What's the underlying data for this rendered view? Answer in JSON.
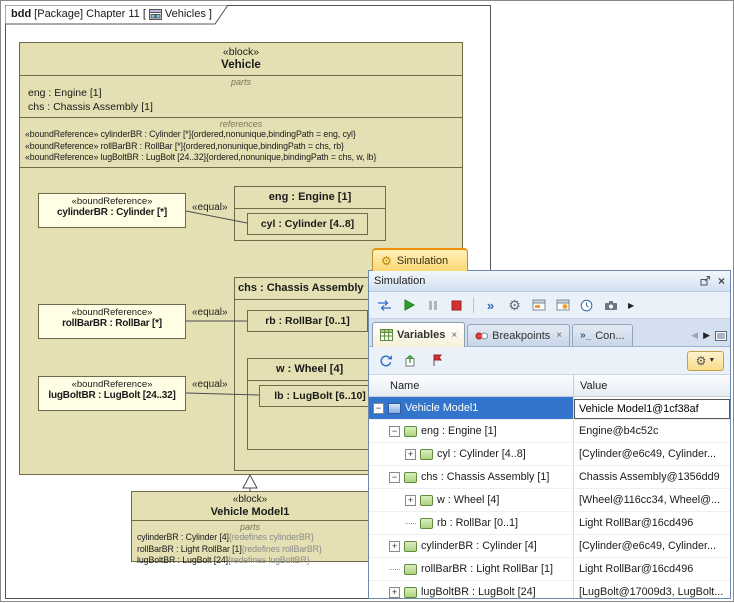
{
  "frame": {
    "kind": "bdd",
    "context": " [Package] Chapter 11 [",
    "diagram_name": "Vehicles",
    "suffix": "]"
  },
  "vehicle": {
    "stereotype": "«block»",
    "name": "Vehicle",
    "parts_label": "parts",
    "parts": [
      "eng : Engine [1]",
      "chs : Chassis Assembly [1]"
    ],
    "references_label": "references",
    "references": [
      "«boundReference» cylinderBR : Cylinder [*]{ordered,nonunique,bindingPath = eng, cyl}",
      "«boundReference» rollBarBR : RollBar [*]{ordered,nonunique,bindingPath = chs, rb}",
      "«boundReference» lugBoltBR : LugBolt [24..32]{ordered,nonunique,bindingPath = chs, w, lb}"
    ]
  },
  "bound_refs": [
    {
      "stereotype": "«boundReference»",
      "name": "cylinderBR : Cylinder [*]"
    },
    {
      "stereotype": "«boundReference»",
      "name": "rollBarBR : RollBar [*]"
    },
    {
      "stereotype": "«boundReference»",
      "name": "lugBoltBR : LugBolt [24..32]"
    }
  ],
  "connectors": {
    "equal_label": "«equal»"
  },
  "parts": {
    "eng_title": "eng : Engine [1]",
    "cyl": "cyl : Cylinder [4..8]",
    "chs_title": "chs : Chassis Assembly",
    "rb": "rb : RollBar [0..1]",
    "w_title": "w : Wheel [4]",
    "lb": "lb : LugBolt [6..10]"
  },
  "vehicle_model1": {
    "stereotype": "«block»",
    "name": "Vehicle Model1",
    "parts_label": "parts",
    "parts": [
      {
        "text": "cylinderBR : Cylinder [4]",
        "modifier": "{redefines cylinderBR}"
      },
      {
        "text": "rollBarBR : Light RollBar [1]",
        "modifier": "{redefines rollBarBR}"
      },
      {
        "text": "lugBoltBR : LugBolt [24]",
        "modifier": "{redefines lugBoltBR}"
      }
    ]
  },
  "simulation": {
    "dock_tab_label": "Simulation",
    "window_title": "Simulation",
    "tabs": {
      "variables": "Variables",
      "breakpoints": "Breakpoints",
      "console": "Con..."
    },
    "table": {
      "columns": {
        "name": "Name",
        "value": "Value"
      },
      "rows": [
        {
          "name": "Vehicle Model1",
          "value": "Vehicle Model1@1cf38af"
        },
        {
          "name": "eng : Engine [1]",
          "value": "Engine@b4c52c"
        },
        {
          "name": "cyl : Cylinder [4..8]",
          "value": "[Cylinder@e6c49, Cylinder..."
        },
        {
          "name": "chs : Chassis Assembly [1]",
          "value": "Chassis Assembly@1356dd9"
        },
        {
          "name": "w : Wheel [4]",
          "value": "[Wheel@116cc34, Wheel@..."
        },
        {
          "name": "rb : RollBar [0..1]",
          "value": "Light RollBar@16cd496"
        },
        {
          "name": "cylinderBR : Cylinder [4]",
          "value": "[Cylinder@e6c49, Cylinder..."
        },
        {
          "name": "rollBarBR : Light RollBar [1]",
          "value": "Light RollBar@16cd496"
        },
        {
          "name": "lugBoltBR : LugBolt [24]",
          "value": "[LugBolt@17009d3, LugBolt..."
        }
      ]
    }
  },
  "glyphs": {
    "close": "×",
    "gear": "⚙",
    "caret_down": "▼",
    "scroll_left": "◀",
    "scroll_right": "▶",
    "overflow": "▶",
    "step": "»",
    "console_prefix": "»_"
  }
}
